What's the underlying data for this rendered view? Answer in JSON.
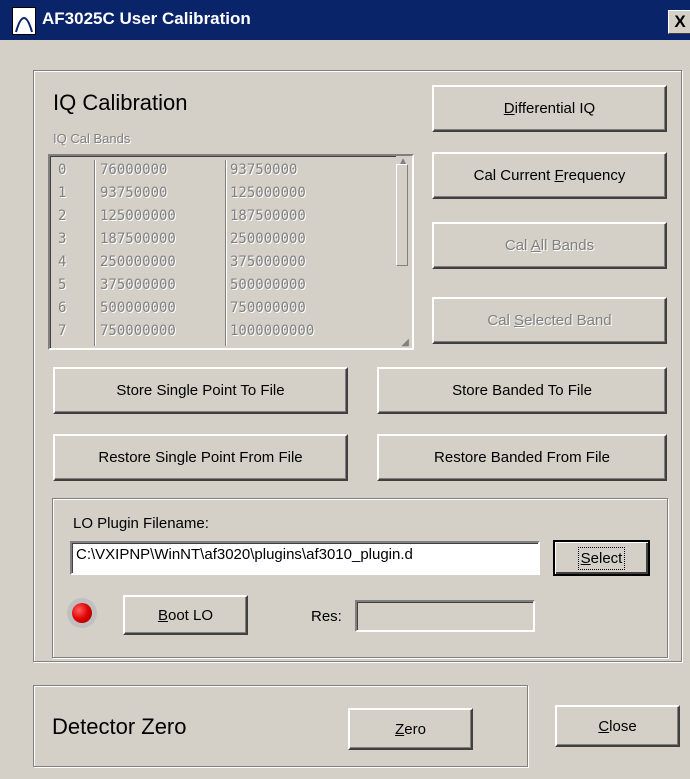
{
  "window": {
    "title": "AF3025C User Calibration",
    "close_glyph": "X"
  },
  "iq": {
    "heading": "IQ Calibration",
    "bands_label": "IQ Cal Bands",
    "bands": [
      {
        "index": "0",
        "start": "76000000",
        "stop": "93750000"
      },
      {
        "index": "1",
        "start": "93750000",
        "stop": "125000000"
      },
      {
        "index": "2",
        "start": "125000000",
        "stop": "187500000"
      },
      {
        "index": "3",
        "start": "187500000",
        "stop": "250000000"
      },
      {
        "index": "4",
        "start": "250000000",
        "stop": "375000000"
      },
      {
        "index": "5",
        "start": "375000000",
        "stop": "500000000"
      },
      {
        "index": "6",
        "start": "500000000",
        "stop": "750000000"
      },
      {
        "index": "7",
        "start": "750000000",
        "stop": "1000000000"
      }
    ]
  },
  "buttons": {
    "differential_iq": {
      "pre": "",
      "key": "D",
      "post": "ifferential IQ"
    },
    "cal_current_freq": {
      "pre": "Cal Current ",
      "key": "F",
      "post": "requency"
    },
    "cal_all_bands": {
      "pre": "Cal ",
      "key": "A",
      "post": "ll Bands"
    },
    "cal_selected_band": {
      "pre": "Cal ",
      "key": "S",
      "post": "elected Band"
    },
    "store_single": "Store Single Point To File",
    "store_banded": "Store Banded To File",
    "restore_single": "Restore Single Point From File",
    "restore_banded": "Restore Banded From File",
    "select": {
      "pre": "",
      "key": "S",
      "post": "elect"
    },
    "boot_lo": {
      "pre": "",
      "key": "B",
      "post": "oot LO"
    },
    "zero": {
      "pre": "",
      "key": "Z",
      "post": "ero"
    },
    "close": {
      "pre": "",
      "key": "C",
      "post": "lose"
    }
  },
  "lo": {
    "filename_label": "LO Plugin Filename:",
    "filename_value": "C:\\VXIPNP\\WinNT\\af3020\\plugins\\af3010_plugin.d",
    "res_label": "Res:",
    "res_value": "",
    "status_color": "#e00000"
  },
  "detector": {
    "heading": "Detector Zero"
  }
}
